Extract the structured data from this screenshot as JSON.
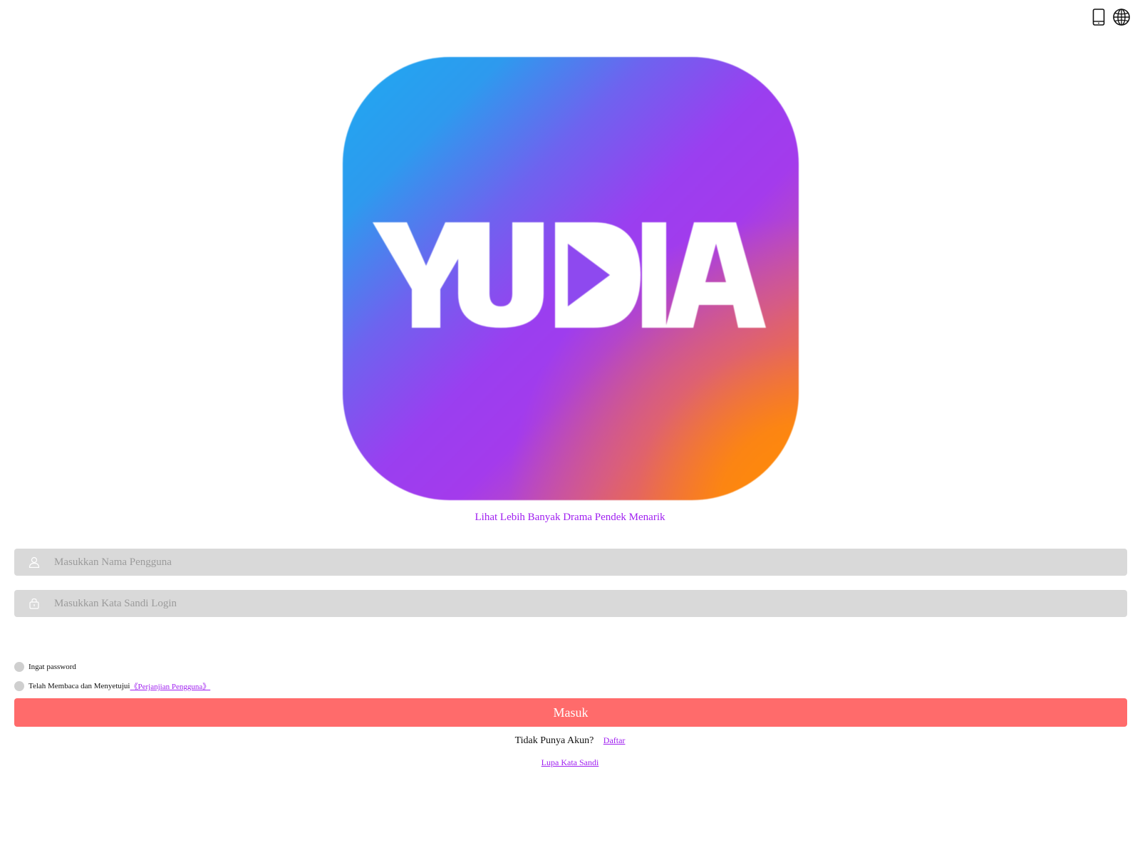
{
  "header": {
    "icons": [
      "tablet-icon",
      "globe-icon"
    ]
  },
  "logo": {
    "text": "YUDIA"
  },
  "tagline": "Lihat Lebih Banyak Drama Pendek Menarik",
  "form": {
    "username_placeholder": "Masukkan Nama Pengguna",
    "username_value": "",
    "password_placeholder": "Masukkan Kata Sandi Login",
    "password_value": "",
    "remember_label": "Ingat password",
    "agree_label": "Telah Membaca dan Menyetujui",
    "agreement_link": "《Perjanjian Pengguna》",
    "login_label": "Masuk"
  },
  "footer": {
    "no_account_text": "Tidak Punya Akun?",
    "register_link": "Daftar",
    "forgot_link": "Lupa Kata Sandi"
  },
  "colors": {
    "accent": "#a020f0",
    "login_button": "#ff6b6b",
    "input_bg": "#d9d9d9"
  }
}
